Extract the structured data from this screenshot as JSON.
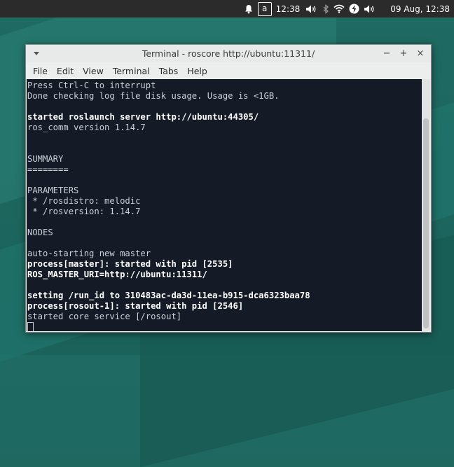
{
  "panel": {
    "keyboard_indicator": "a",
    "clock": "12:38",
    "date": "09 Aug, 12:38",
    "icons": [
      "bell-icon",
      "keyboard-layout-icon",
      "volume-icon",
      "bluetooth-icon",
      "wifi-icon",
      "power-icon",
      "volume-icon"
    ]
  },
  "window": {
    "title": "Terminal - roscore http://ubuntu:11311/",
    "controls": {
      "minimize": "−",
      "maximize": "+",
      "close": "×"
    },
    "menu": [
      "File",
      "Edit",
      "View",
      "Terminal",
      "Tabs",
      "Help"
    ]
  },
  "terminal": {
    "lines": [
      {
        "text": "Press Ctrl-C to interrupt",
        "bold": false
      },
      {
        "text": "Done checking log file disk usage. Usage is <1GB.",
        "bold": false
      },
      {
        "text": "",
        "bold": false
      },
      {
        "text": "started roslaunch server http://ubuntu:44305/",
        "bold": true
      },
      {
        "text": "ros_comm version 1.14.7",
        "bold": false
      },
      {
        "text": "",
        "bold": false
      },
      {
        "text": "",
        "bold": false
      },
      {
        "text": "SUMMARY",
        "bold": false
      },
      {
        "text": "========",
        "bold": false
      },
      {
        "text": "",
        "bold": false
      },
      {
        "text": "PARAMETERS",
        "bold": false
      },
      {
        "text": " * /rosdistro: melodic",
        "bold": false
      },
      {
        "text": " * /rosversion: 1.14.7",
        "bold": false
      },
      {
        "text": "",
        "bold": false
      },
      {
        "text": "NODES",
        "bold": false
      },
      {
        "text": "",
        "bold": false
      },
      {
        "text": "auto-starting new master",
        "bold": false
      },
      {
        "text": "process[master]: started with pid [2535]",
        "bold": true
      },
      {
        "text": "ROS_MASTER_URI=http://ubuntu:11311/",
        "bold": true
      },
      {
        "text": "",
        "bold": false
      },
      {
        "text": "setting /run_id to 310483ac-da3d-11ea-b915-dca6323baa78",
        "bold": true
      },
      {
        "text": "process[rosout-1]: started with pid [2546]",
        "bold": true
      },
      {
        "text": "started core service [/rosout]",
        "bold": false
      }
    ]
  }
}
